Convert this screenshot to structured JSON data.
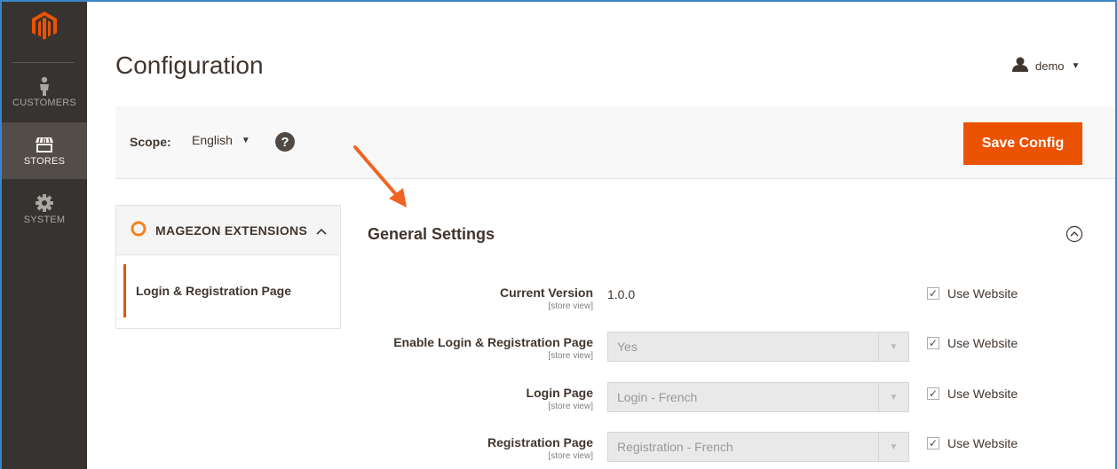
{
  "sidebar": {
    "logo": "magento-logo",
    "items": [
      {
        "label": "CUSTOMERS",
        "icon": "customers-icon",
        "active": false
      },
      {
        "label": "STORES",
        "icon": "stores-icon",
        "active": true
      },
      {
        "label": "SYSTEM",
        "icon": "system-gear-icon",
        "active": false
      }
    ]
  },
  "header": {
    "title": "Configuration",
    "user": "demo"
  },
  "scope": {
    "label": "Scope:",
    "value": "English",
    "help": "?"
  },
  "toolbar": {
    "save_label": "Save Config"
  },
  "config_nav": {
    "group": "MAGEZON EXTENSIONS",
    "items": [
      {
        "label": "Login & Registration Page",
        "active": true
      }
    ]
  },
  "section": {
    "title": "General Settings",
    "rows": [
      {
        "label": "Current Version",
        "scope": "[store view]",
        "value": "1.0.0",
        "use_website": "Use Website"
      },
      {
        "label": "Enable Login & Registration Page",
        "scope": "[store view]",
        "value": "Yes",
        "use_website": "Use Website"
      },
      {
        "label": "Login Page",
        "scope": "[store view]",
        "value": "Login - French",
        "use_website": "Use Website"
      },
      {
        "label": "Registration Page",
        "scope": "[store view]",
        "value": "Registration - French",
        "use_website": "Use Website"
      }
    ]
  },
  "colors": {
    "accent": "#eb5202",
    "sidebar": "#373330",
    "text": "#41362f"
  }
}
